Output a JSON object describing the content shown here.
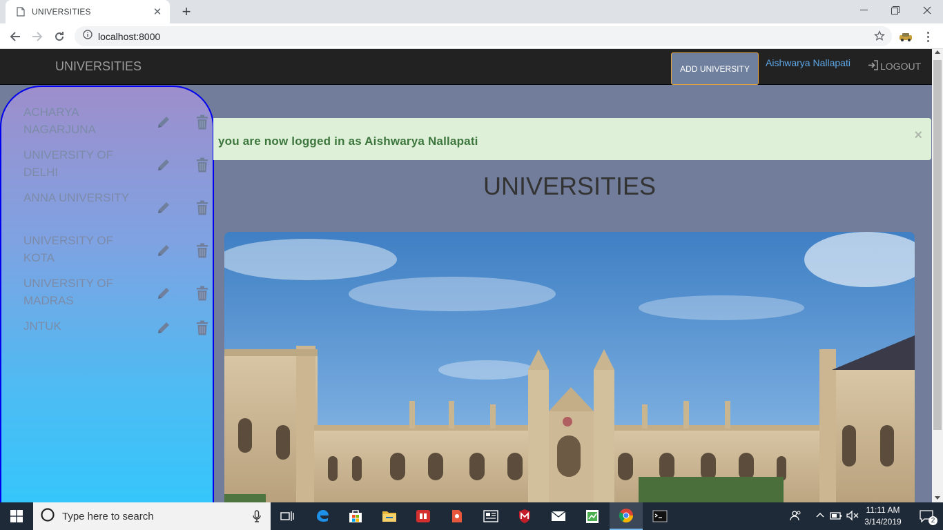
{
  "browser": {
    "tab_title": "UNIVERSITIES",
    "url": "localhost:8000"
  },
  "navbar": {
    "brand": "UNIVERSITIES",
    "add_button": "ADD UNIVERSITY",
    "user": "Aishwarya Nallapati",
    "logout": "LOGOUT"
  },
  "sidebar": {
    "items": [
      {
        "name": "ACHARYA NAGARJUNA"
      },
      {
        "name": "UNIVERSITY OF DELHI"
      },
      {
        "name": "ANNA UNIVERSITY"
      },
      {
        "name": "UNIVERSITY OF KOTA"
      },
      {
        "name": "UNIVERSITY OF MADRAS"
      },
      {
        "name": "JNTUK"
      }
    ]
  },
  "alert": {
    "message": "you are now logged in as Aishwarya Nallapati",
    "close": "×"
  },
  "main": {
    "title": "UNIVERSITIES"
  },
  "taskbar": {
    "search_placeholder": "Type here to search",
    "time": "11:11 AM",
    "date": "3/14/2019",
    "notification_count": "2"
  },
  "colors": {
    "page_bg": "#717d9a",
    "navbar_bg": "#222222",
    "alert_bg": "#dff0d8",
    "alert_text": "#3c763d",
    "sidebar_border": "#0000ee"
  }
}
